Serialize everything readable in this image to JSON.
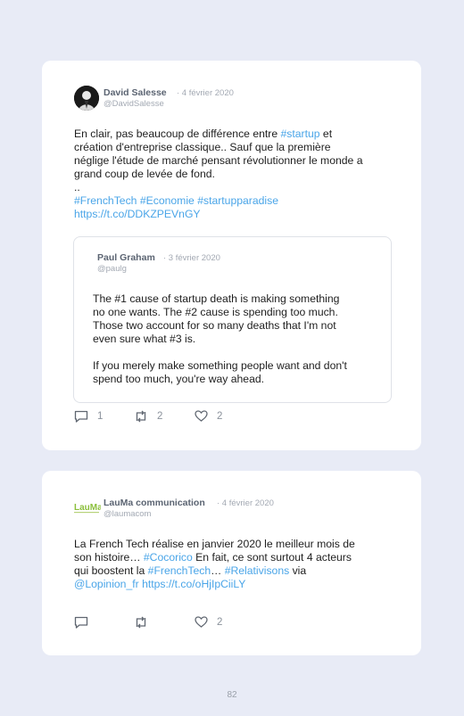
{
  "tweets": [
    {
      "author": "David Salesse",
      "date": "· 4 février 2020",
      "handle": "@DavidSalesse",
      "lines": [
        [
          {
            "t": "En clair, pas beaucoup de différence entre "
          },
          {
            "t": "#startup",
            "link": true
          },
          {
            "t": " et"
          }
        ],
        [
          {
            "t": "création d'entreprise classique.. Sauf que la première"
          }
        ],
        [
          {
            "t": "néglige l'étude de marché pensant révolutionner le monde a"
          }
        ],
        [
          {
            "t": "grand coup de levée de fond."
          }
        ],
        [
          {
            "t": ".."
          }
        ],
        [
          {
            "t": "#FrenchTech #Economie #startupparadise",
            "link": true
          }
        ],
        [
          {
            "t": "https://t.co/DDKZPEVnGY",
            "link": true
          }
        ]
      ],
      "quote": {
        "author": "Paul Graham",
        "date": "· 3 février 2020",
        "handle": "@paulg",
        "lines": [
          "The #1 cause of startup death is making something",
          "no one wants. The #2 cause is spending too much.",
          "Those two account for so many deaths that I'm not",
          "even sure what #3 is.",
          "",
          "If you merely make something people want and don't",
          "spend too much, you're way ahead."
        ]
      },
      "replies": "1",
      "retweets": "2",
      "likes": "2"
    },
    {
      "author": "LauMa communication",
      "date": "· 4 février 2020",
      "handle": "@laumacom",
      "avatar_text": "LauMa",
      "lines": [
        [
          {
            "t": "La French Tech réalise en janvier 2020 le meilleur mois de"
          }
        ],
        [
          {
            "t": "son histoire… "
          },
          {
            "t": "#Cocorico",
            "link": true
          },
          {
            "t": " En fait, ce sont surtout 4 acteurs"
          }
        ],
        [
          {
            "t": "qui boostent la "
          },
          {
            "t": "#FrenchTech",
            "link": true
          },
          {
            "t": "… "
          },
          {
            "t": "#Relativisons",
            "link": true
          },
          {
            "t": " via"
          }
        ],
        [
          {
            "t": "@Lopinion_fr https://t.co/oHjIpCiiLY",
            "link": true
          }
        ]
      ],
      "replies": "",
      "retweets": "",
      "likes": "2"
    }
  ],
  "page_number": "82",
  "colors": {
    "link": "#4aa5e8",
    "text": "#1e1e1e",
    "muted": "#a3a9b3",
    "background": "#e8ebf6"
  }
}
